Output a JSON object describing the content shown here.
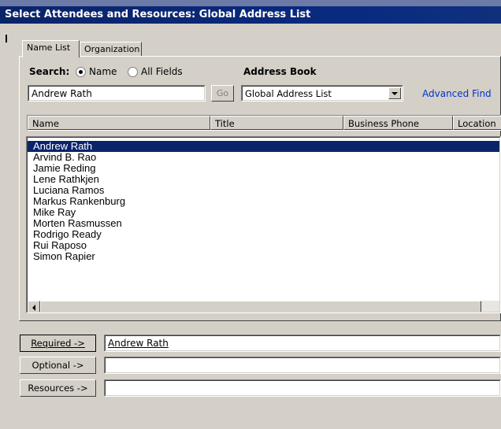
{
  "window": {
    "title": "Select Attendees and Resources: Global Address List"
  },
  "tabs": [
    {
      "label": "Name List"
    },
    {
      "label": "Organization"
    }
  ],
  "search": {
    "label": "Search:",
    "options": [
      {
        "label": "Name",
        "selected": true
      },
      {
        "label": "All Fields",
        "selected": false
      }
    ],
    "value": "Andrew Rath",
    "go_label": "Go"
  },
  "address_book": {
    "label": "Address Book",
    "selected": "Global Address List"
  },
  "advanced_find_label": "Advanced Find",
  "columns": [
    "Name",
    "Title",
    "Business Phone",
    "Location"
  ],
  "people": [
    "Andrew Rath",
    "Arvind B. Rao",
    "Jamie Reding",
    "Lene Rathkjen",
    "Luciana Ramos",
    "Markus Rankenburg",
    "Mike Ray",
    "Morten Rasmussen",
    "Rodrigo Ready",
    "Rui Raposo",
    "Simon Rapier"
  ],
  "selected_person": "Andrew Rath",
  "fields": {
    "required_label": "Required ->",
    "required_value": "Andrew Rath",
    "optional_label": "Optional ->",
    "optional_value": "",
    "resources_label": "Resources ->",
    "resources_value": ""
  },
  "colors": {
    "title_bar": "#0a246a",
    "dialog_face": "#d4d0c8",
    "link": "#0033cc",
    "selection": "#0a246a"
  }
}
